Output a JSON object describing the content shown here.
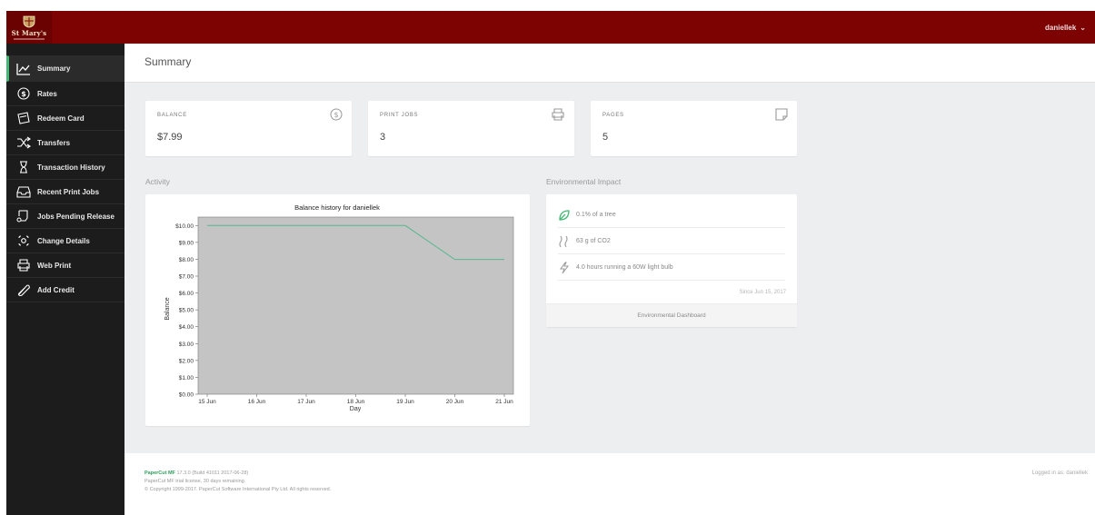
{
  "header": {
    "logo_text": "St Mary's",
    "logo_motto": "",
    "username": "daniellek",
    "menu_icon": "chevron-down-icon",
    "bar_color": "#7d0303"
  },
  "sidebar": {
    "items": [
      {
        "label": "Summary",
        "icon": "chart-line-icon",
        "active": true
      },
      {
        "label": "Rates",
        "icon": "dollar-circle-icon"
      },
      {
        "label": "Redeem Card",
        "icon": "card-icon"
      },
      {
        "label": "Transfers",
        "icon": "transfer-arrows-icon"
      },
      {
        "label": "Transaction History",
        "icon": "hourglass-icon"
      },
      {
        "label": "Recent Print Jobs",
        "icon": "inbox-icon"
      },
      {
        "label": "Jobs Pending Release",
        "icon": "jobs-pending-icon"
      },
      {
        "label": "Change Details",
        "icon": "gear-icon"
      },
      {
        "label": "Web Print",
        "icon": "printer-icon"
      },
      {
        "label": "Add Credit",
        "icon": "paperclip-icon"
      }
    ],
    "accent_color": "#43b874"
  },
  "main": {
    "title": "Summary",
    "stats": [
      {
        "label": "BALANCE",
        "value": "$7.99",
        "icon": "dollar-circle-icon"
      },
      {
        "label": "PRINT JOBS",
        "value": "3",
        "icon": "printer-icon"
      },
      {
        "label": "PAGES",
        "value": "5",
        "icon": "page-icon"
      }
    ],
    "activity_title": "Activity",
    "environment": {
      "title": "Environmental Impact",
      "rows": [
        {
          "text": "0.1% of a tree",
          "icon": "leaf-icon"
        },
        {
          "text": "63 g of CO2",
          "icon": "co2-wave-icon"
        },
        {
          "text": "4.0 hours running a 60W light bulb",
          "icon": "lightning-icon"
        }
      ],
      "since": "Since Jun 15, 2017",
      "dashboard_link": "Environmental Dashboard",
      "leaf_color": "#43b874"
    }
  },
  "chart_data": {
    "type": "line",
    "title": "Balance history for daniellek",
    "xlabel": "Day",
    "ylabel": "Balance",
    "categories": [
      "15 Jun",
      "16 Jun",
      "17 Jun",
      "18 Jun",
      "19 Jun",
      "20 Jun",
      "21 Jun"
    ],
    "series": [
      {
        "values": [
          10.0,
          10.0,
          10.0,
          10.0,
          10.0,
          7.99,
          7.99
        ]
      }
    ],
    "y_ticks": [
      "$0.00",
      "$1.00",
      "$2.00",
      "$3.00",
      "$4.00",
      "$5.00",
      "$6.00",
      "$7.00",
      "$8.00",
      "$9.00",
      "$10.00"
    ],
    "ylim": [
      0,
      10.5
    ],
    "plot_background": "#c4c4c4",
    "line_color": "#56b88e",
    "grid": false,
    "legend": "none"
  },
  "footer": {
    "brand": "PaperCut MF",
    "version": " 17.3.0 (Build 41011 2017-06-28)",
    "license": "PaperCut MF trial license, 30 days remaining.",
    "copyright": "© Copyright 1999-2017. PaperCut Software International Pty Ltd. All rights reserved.",
    "logged_in": "Logged in as: daniellek"
  }
}
